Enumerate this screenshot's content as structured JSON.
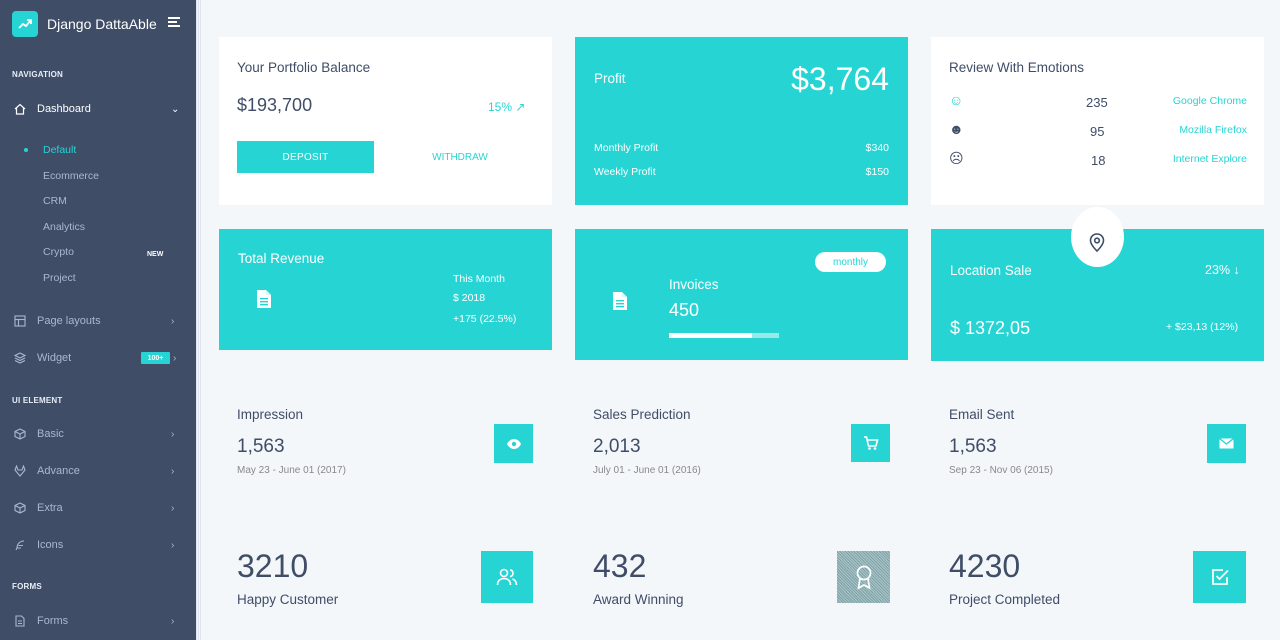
{
  "brand": {
    "name": "Django DattaAble"
  },
  "sidebar": {
    "captions": {
      "navigation": "NAVIGATION",
      "ui_element": "UI ELEMENT",
      "forms": "FORMS"
    },
    "dashboard": {
      "label": "Dashboard"
    },
    "submenu": [
      {
        "label": "Default"
      },
      {
        "label": "Ecommerce"
      },
      {
        "label": "CRM"
      },
      {
        "label": "Analytics"
      },
      {
        "label": "Crypto",
        "badge": "NEW"
      },
      {
        "label": "Project"
      }
    ],
    "page_layouts": {
      "label": "Page layouts"
    },
    "widget": {
      "label": "Widget",
      "badge": "100+"
    },
    "basic": {
      "label": "Basic"
    },
    "advance": {
      "label": "Advance"
    },
    "extra": {
      "label": "Extra"
    },
    "icons": {
      "label": "Icons"
    },
    "forms": {
      "label": "Forms"
    }
  },
  "portfolio": {
    "title": "Your Portfolio Balance",
    "balance": "$193,700",
    "change": "15%",
    "deposit_label": "DEPOSIT",
    "withdraw_label": "WITHDRAW"
  },
  "profit": {
    "title": "Profit",
    "amount": "$3,764",
    "monthly_label": "Monthly Profit",
    "monthly_value": "$340",
    "weekly_label": "Weekly Profit",
    "weekly_value": "$150"
  },
  "emotions": {
    "title": "Review With Emotions",
    "rows": [
      {
        "count": "235",
        "browser": "Google Chrome"
      },
      {
        "count": "95",
        "browser": "Mozilla Firefox"
      },
      {
        "count": "18",
        "browser": "Internet Explore"
      }
    ]
  },
  "revenue": {
    "title": "Total Revenue",
    "period": "This Month",
    "amount": "$ 2018",
    "change": "+175 (22.5%)"
  },
  "invoices": {
    "badge": "monthly",
    "title": "Invoices",
    "value": "450",
    "progress": 0.75
  },
  "location": {
    "title": "Location Sale",
    "change": "23%",
    "amount": "$ 1372,05",
    "delta": "+ $23,13 (12%)"
  },
  "stats": [
    {
      "title": "Impression",
      "value": "1,563",
      "range": "May 23 - June 01 (2017)"
    },
    {
      "title": "Sales Prediction",
      "value": "2,013",
      "range": "July 01 - June 01 (2016)"
    },
    {
      "title": "Email Sent",
      "value": "1,563",
      "range": "Sep 23 - Nov 06 (2015)"
    }
  ],
  "counters": [
    {
      "value": "3210",
      "label": "Happy Customer"
    },
    {
      "value": "432",
      "label": "Award Winning"
    },
    {
      "value": "4230",
      "label": "Project Completed"
    }
  ],
  "colors": {
    "accent": "#27d4d4",
    "sidebar": "#3f4d67",
    "background": "#f4f7fa"
  }
}
